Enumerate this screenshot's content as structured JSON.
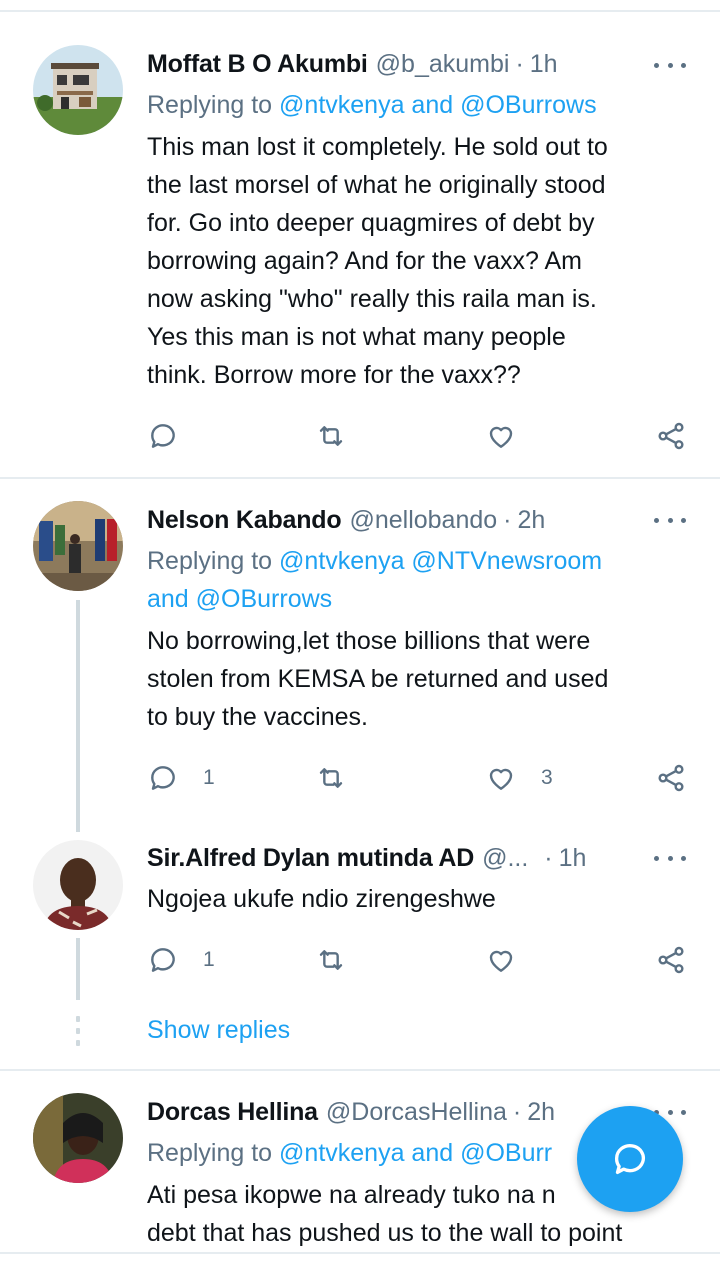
{
  "colors": {
    "accent": "#1da1f2",
    "secondary_text": "#5b7083",
    "primary_text": "#0f1419",
    "divider": "#e6ecf0"
  },
  "tweets": [
    {
      "name": "Moffat B O Akumbi",
      "handle": "@b_akumbi",
      "sep": "·",
      "time": "1h",
      "replying_prefix": "Replying to",
      "replying_mentions": "@ntvkenya and @OBurrows",
      "lines": [
        "This man lost it completely. He sold out to",
        "the last morsel of what he originally stood",
        "for. Go into deeper quagmires of debt by",
        "borrowing again? And for the vaxx? Am",
        "now asking \"who\" really this raila man is.",
        "Yes this man is not what many people",
        "think. Borrow more for the vaxx??"
      ],
      "reply_count": "",
      "like_count": ""
    },
    {
      "name": "Nelson Kabando",
      "handle": "@nellobando",
      "sep": "·",
      "time": "2h",
      "replying_prefix": "Replying to",
      "replying_mentions_1": "@ntvkenya @NTVnewsroom",
      "replying_mentions_2": "and @OBurrows",
      "lines": [
        "No borrowing,let those billions that were",
        "stolen from KEMSA be returned and used",
        "to buy the vaccines."
      ],
      "reply_count": "1",
      "like_count": "3"
    },
    {
      "name": "Sir.Alfred Dylan mutinda AD",
      "handle": "@...",
      "sep": "·",
      "time": "1h",
      "lines": [
        "Ngojea ukufe ndio zirengeshwe"
      ],
      "reply_count": "1",
      "like_count": ""
    },
    {
      "name": "Dorcas Hellina",
      "handle": "@DorcasHellina",
      "sep": "·",
      "time": "2h",
      "replying_prefix": "Replying to",
      "replying_mentions": "@ntvkenya and @OBurr",
      "lines": [
        "Ati pesa ikopwe na already tuko na n",
        "debt that has pushed us to the wall to point"
      ]
    }
  ],
  "show_replies": "Show replies",
  "icons": {
    "reply": "reply-icon",
    "retweet": "retweet-icon",
    "like": "heart-icon",
    "share": "share-icon",
    "more": "more-options-icon",
    "fab": "compose-reply-icon"
  }
}
